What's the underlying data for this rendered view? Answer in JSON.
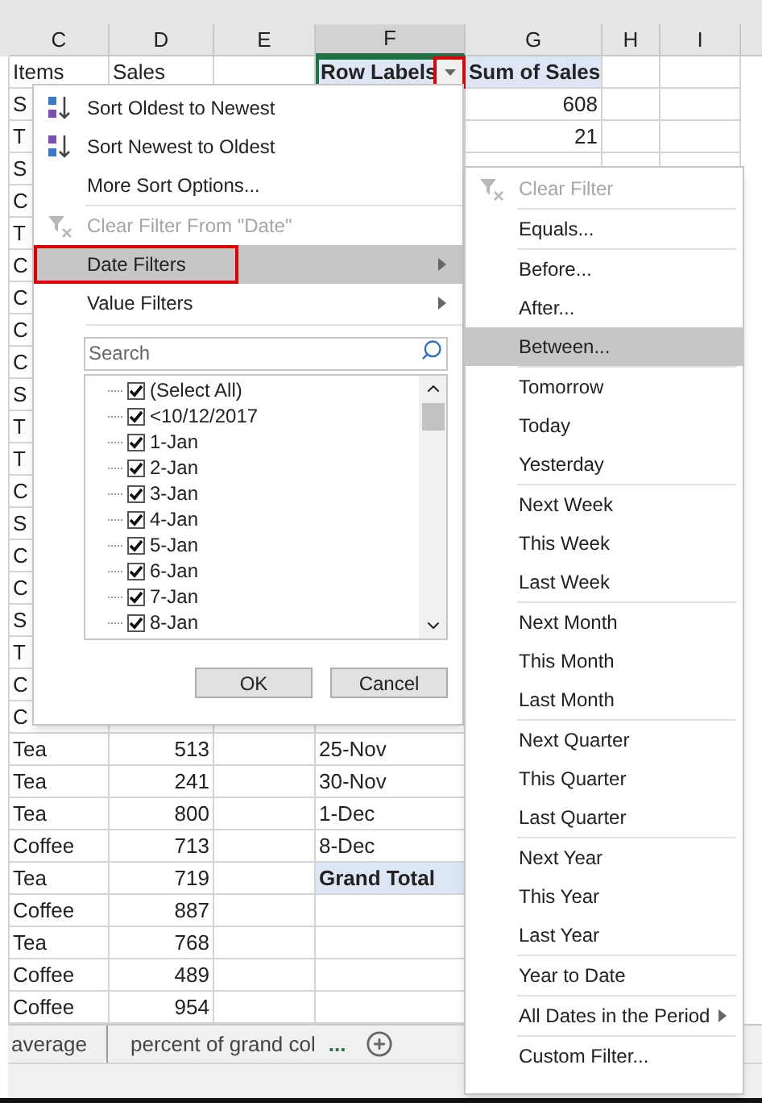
{
  "column_headers": [
    {
      "label": "C",
      "selected": false
    },
    {
      "label": "D",
      "selected": false
    },
    {
      "label": "E",
      "selected": false
    },
    {
      "label": "F",
      "selected": true
    },
    {
      "label": "G",
      "selected": false
    },
    {
      "label": "H",
      "selected": false
    },
    {
      "label": "I",
      "selected": false
    }
  ],
  "header_row": {
    "item": "Items",
    "sales": "Sales",
    "row_label": "Row Labels",
    "sum": "Sum of Sales",
    "filter_outlined": true
  },
  "covered_rows": [
    {
      "item": "S",
      "sum": "608"
    },
    {
      "item": "T",
      "sum": "21"
    },
    {
      "item": "S"
    },
    {
      "item": "C"
    },
    {
      "item": "T"
    },
    {
      "item": "C"
    },
    {
      "item": "C"
    },
    {
      "item": "C"
    },
    {
      "item": "C"
    },
    {
      "item": "S"
    },
    {
      "item": "T"
    },
    {
      "item": "T"
    },
    {
      "item": "C"
    },
    {
      "item": "S"
    },
    {
      "item": "C"
    },
    {
      "item": "C"
    },
    {
      "item": "S"
    },
    {
      "item": "T"
    },
    {
      "item": "C"
    },
    {
      "item": "C"
    }
  ],
  "rows": [
    {
      "kind": "data",
      "item": "Tea",
      "sales": "513",
      "row_label": "25-Nov"
    },
    {
      "kind": "data",
      "item": "Tea",
      "sales": "241",
      "row_label": "30-Nov"
    },
    {
      "kind": "data",
      "item": "Tea",
      "sales": "800",
      "row_label": "1-Dec"
    },
    {
      "kind": "data",
      "item": "Coffee",
      "sales": "713",
      "row_label": "8-Dec"
    },
    {
      "kind": "total",
      "item": "Tea",
      "sales": "719",
      "row_label": "Grand Total"
    },
    {
      "kind": "data",
      "item": "Coffee",
      "sales": "887"
    },
    {
      "kind": "data",
      "item": "Tea",
      "sales": "768"
    },
    {
      "kind": "data",
      "item": "Coffee",
      "sales": "489"
    },
    {
      "kind": "data",
      "item": "Coffee",
      "sales": "954"
    }
  ],
  "filter_menu": {
    "groups": [
      [
        {
          "kind": "sort-ascending",
          "label": "Sort Oldest to Newest",
          "selected": false,
          "disabled": false,
          "outlined": false
        },
        {
          "kind": "sort-descending",
          "label": "Sort Newest to Oldest",
          "selected": false,
          "disabled": false,
          "outlined": false
        },
        {
          "kind": "item",
          "label": "More Sort Options...",
          "selected": false,
          "disabled": false,
          "outlined": false
        }
      ],
      [
        {
          "kind": "clear-filter",
          "label": "Clear Filter From \"Date\"",
          "selected": false,
          "disabled": true,
          "outlined": false
        },
        {
          "kind": "submenu",
          "label": "Date Filters",
          "selected": true,
          "disabled": false,
          "outlined": true
        },
        {
          "kind": "submenu",
          "label": "Value Filters",
          "selected": false,
          "disabled": false,
          "outlined": false
        }
      ]
    ],
    "search": {
      "placeholder": "Search"
    },
    "checklist": [
      {
        "label": "(Select All)",
        "checked": true
      },
      {
        "label": "<10/12/2017",
        "checked": true
      },
      {
        "label": "1-Jan",
        "checked": true
      },
      {
        "label": "2-Jan",
        "checked": true
      },
      {
        "label": "3-Jan",
        "checked": true
      },
      {
        "label": "4-Jan",
        "checked": true
      },
      {
        "label": "5-Jan",
        "checked": true
      },
      {
        "label": "6-Jan",
        "checked": true
      },
      {
        "label": "7-Jan",
        "checked": true
      },
      {
        "label": "8-Jan",
        "checked": true
      }
    ],
    "buttons": [
      "OK",
      "Cancel"
    ]
  },
  "date_filters_menu": {
    "groups": [
      [
        {
          "kind": "clear-filter",
          "label": "Clear Filter",
          "selected": false,
          "disabled": true
        }
      ],
      [
        {
          "kind": "item",
          "label": "Equals...",
          "selected": false,
          "disabled": false
        }
      ],
      [
        {
          "kind": "item",
          "label": "Before...",
          "selected": false,
          "disabled": false
        },
        {
          "kind": "item",
          "label": "After...",
          "selected": false,
          "disabled": false
        },
        {
          "kind": "item",
          "label": "Between...",
          "selected": true,
          "disabled": false
        }
      ],
      [
        {
          "kind": "item",
          "label": "Tomorrow",
          "selected": false,
          "disabled": false
        },
        {
          "kind": "item",
          "label": "Today",
          "selected": false,
          "disabled": false
        },
        {
          "kind": "item",
          "label": "Yesterday",
          "selected": false,
          "disabled": false
        }
      ],
      [
        {
          "kind": "item",
          "label": "Next Week",
          "selected": false,
          "disabled": false
        },
        {
          "kind": "item",
          "label": "This Week",
          "selected": false,
          "disabled": false
        },
        {
          "kind": "item",
          "label": "Last Week",
          "selected": false,
          "disabled": false
        }
      ],
      [
        {
          "kind": "item",
          "label": "Next Month",
          "selected": false,
          "disabled": false
        },
        {
          "kind": "item",
          "label": "This Month",
          "selected": false,
          "disabled": false
        },
        {
          "kind": "item",
          "label": "Last Month",
          "selected": false,
          "disabled": false
        }
      ],
      [
        {
          "kind": "item",
          "label": "Next Quarter",
          "selected": false,
          "disabled": false
        },
        {
          "kind": "item",
          "label": "This Quarter",
          "selected": false,
          "disabled": false
        },
        {
          "kind": "item",
          "label": "Last Quarter",
          "selected": false,
          "disabled": false
        }
      ],
      [
        {
          "kind": "item",
          "label": "Next Year",
          "selected": false,
          "disabled": false
        },
        {
          "kind": "item",
          "label": "This Year",
          "selected": false,
          "disabled": false
        },
        {
          "kind": "item",
          "label": "Last Year",
          "selected": false,
          "disabled": false
        }
      ],
      [
        {
          "kind": "item",
          "label": "Year to Date",
          "selected": false,
          "disabled": false
        }
      ],
      [
        {
          "kind": "submenu",
          "label": "All Dates in the Period",
          "selected": false,
          "disabled": false
        }
      ],
      [
        {
          "kind": "item",
          "label": "Custom Filter...",
          "selected": false,
          "disabled": false
        }
      ]
    ]
  },
  "sheet_tabs": [
    {
      "label": "average",
      "selected": false
    },
    {
      "label": "percent of grand col",
      "selected": false
    }
  ],
  "more_tabs": "..."
}
